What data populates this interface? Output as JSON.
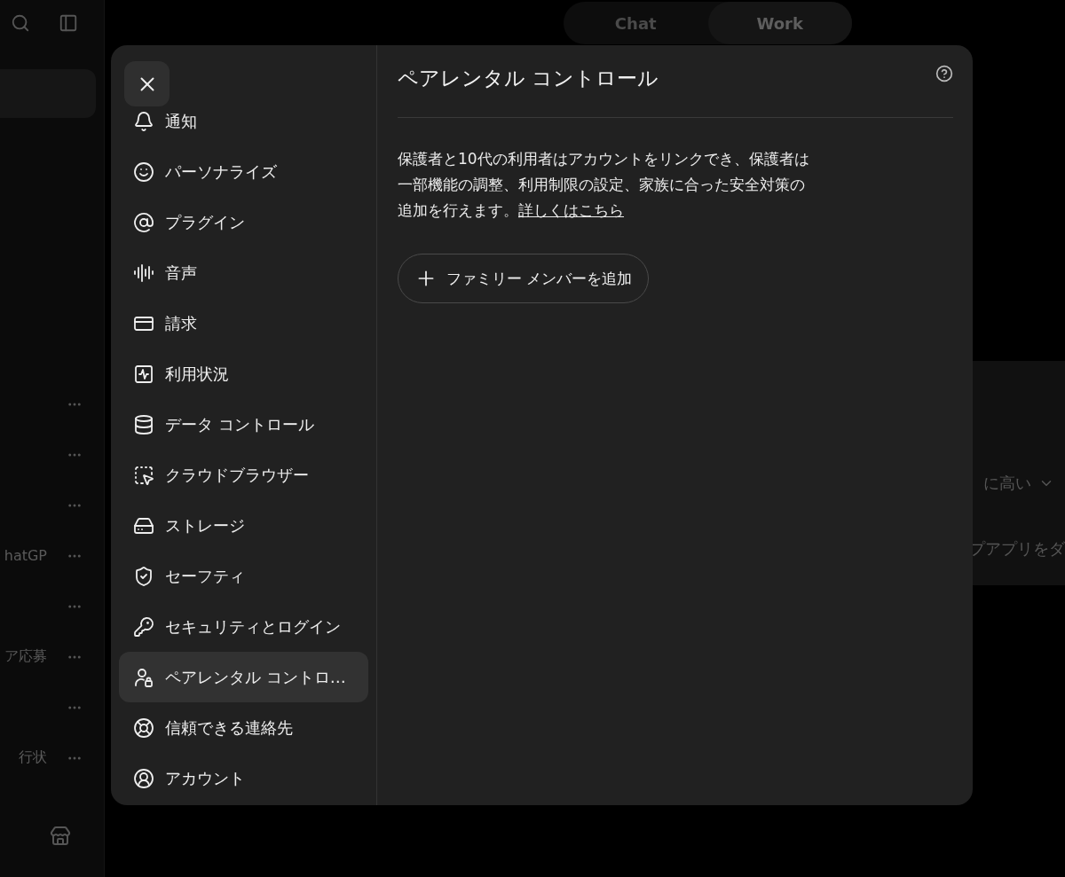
{
  "sidebar": {
    "recent_items": [
      {
        "menu": true
      },
      {
        "menu": true
      },
      {
        "menu": true
      },
      {
        "title": "hatGP",
        "menu": true
      },
      {
        "menu": true
      },
      {
        "title": "ア応募",
        "menu": true
      },
      {
        "menu": true
      },
      {
        "title": "行状",
        "menu": true
      }
    ]
  },
  "mode_toggle": [
    {
      "label": "Chat",
      "selected": false
    },
    {
      "label": "Work",
      "selected": true
    }
  ],
  "background_panel": {
    "rows": [
      {
        "kind": "dropdown",
        "text": "に高い"
      },
      {
        "kind": "text",
        "text": "プアプリをダ"
      }
    ]
  },
  "settings": {
    "nav": [
      {
        "label": "通知",
        "selected": false
      },
      {
        "label": "パーソナライズ",
        "selected": false
      },
      {
        "label": "プラグイン",
        "selected": false
      },
      {
        "label": "音声",
        "selected": false
      },
      {
        "label": "請求",
        "selected": false
      },
      {
        "label": "利用状況",
        "selected": false
      },
      {
        "label": "データ コントロール",
        "selected": false
      },
      {
        "label": "クラウドブラウザー",
        "selected": false
      },
      {
        "label": "ストレージ",
        "selected": false
      },
      {
        "label": "セーフティ",
        "selected": false
      },
      {
        "label": "セキュリティとログイン",
        "selected": false
      },
      {
        "label": "ペアレンタル コントロ…",
        "selected": true
      },
      {
        "label": "信頼できる連絡先",
        "selected": false
      },
      {
        "label": "アカウント",
        "selected": false
      }
    ],
    "title": "ペアレンタル コントロール",
    "description_lines": [
      "保護者と10代の利用者はアカウントをリンクでき、保護者は",
      "一部機能の調整、利用制限の設定、家族に合った安全対策の",
      "追加を行えます。"
    ],
    "link": "詳しくはこちら",
    "add_button": "ファミリー メンバーを追加"
  }
}
